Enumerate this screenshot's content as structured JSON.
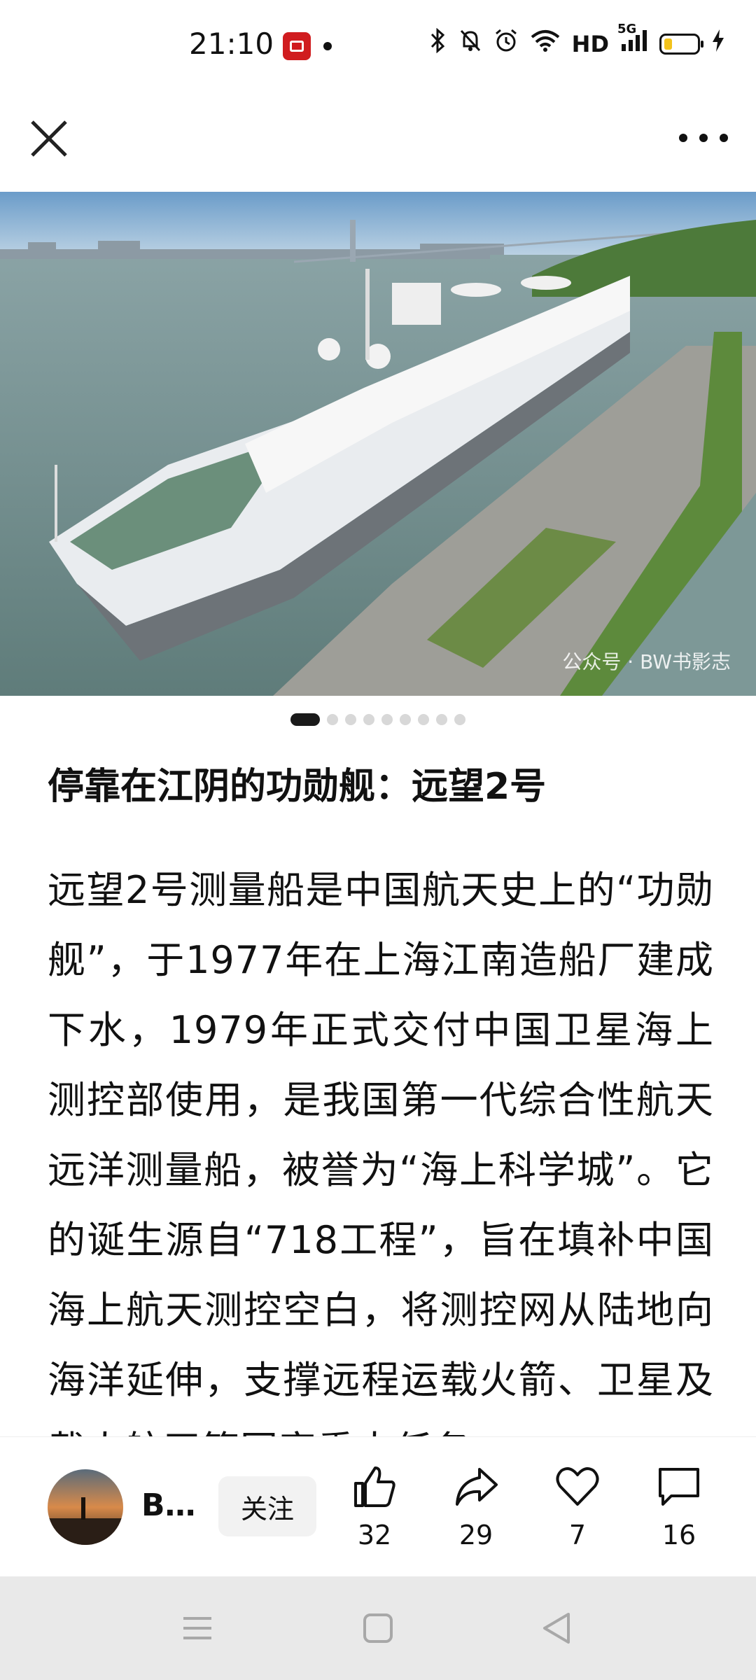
{
  "status_bar": {
    "time": "21:10",
    "network_label": "HD",
    "signal_label": "5G",
    "icons": [
      "bluetooth-icon",
      "mute-icon",
      "alarm-icon",
      "wifi-icon",
      "signal-icon",
      "battery-icon",
      "charging-icon"
    ],
    "battery_level": 0.25,
    "battery_color": "#f2c21b"
  },
  "nav": {
    "close_icon": "close-icon",
    "more_icon": "more-icon"
  },
  "hero": {
    "watermark": "公众号 · BW书影志",
    "carousel_count": 9,
    "carousel_active": 0
  },
  "article": {
    "title": "停靠在江阴的功勋舰：远望2号",
    "body": "远望2号测量船是中国航天史上的“功勋舰”，于1977年在上海江南造船厂建成下水，1979年正式交付中国卫星海上测控部使用，是我国第一代综合性航天远洋测量船，被誉为“海上科学城”。它的诞生源自“718工程”，旨在填补中国海上航天测控空白，将测控网从陆地向海洋延伸，支撑远程运载火箭、卫星及载人航天等国家重大任务。"
  },
  "bottom_bar": {
    "author": "B…",
    "follow_label": "关注",
    "actions": [
      {
        "name": "like",
        "icon": "thumbs-up-icon",
        "count": "32"
      },
      {
        "name": "share",
        "icon": "share-icon",
        "count": "29"
      },
      {
        "name": "favorite",
        "icon": "heart-icon",
        "count": "7"
      },
      {
        "name": "comment",
        "icon": "comment-icon",
        "count": "16"
      }
    ]
  },
  "system_nav": {
    "buttons": [
      "menu-icon",
      "home-icon",
      "back-icon"
    ],
    "background": "#e9e9e9"
  }
}
